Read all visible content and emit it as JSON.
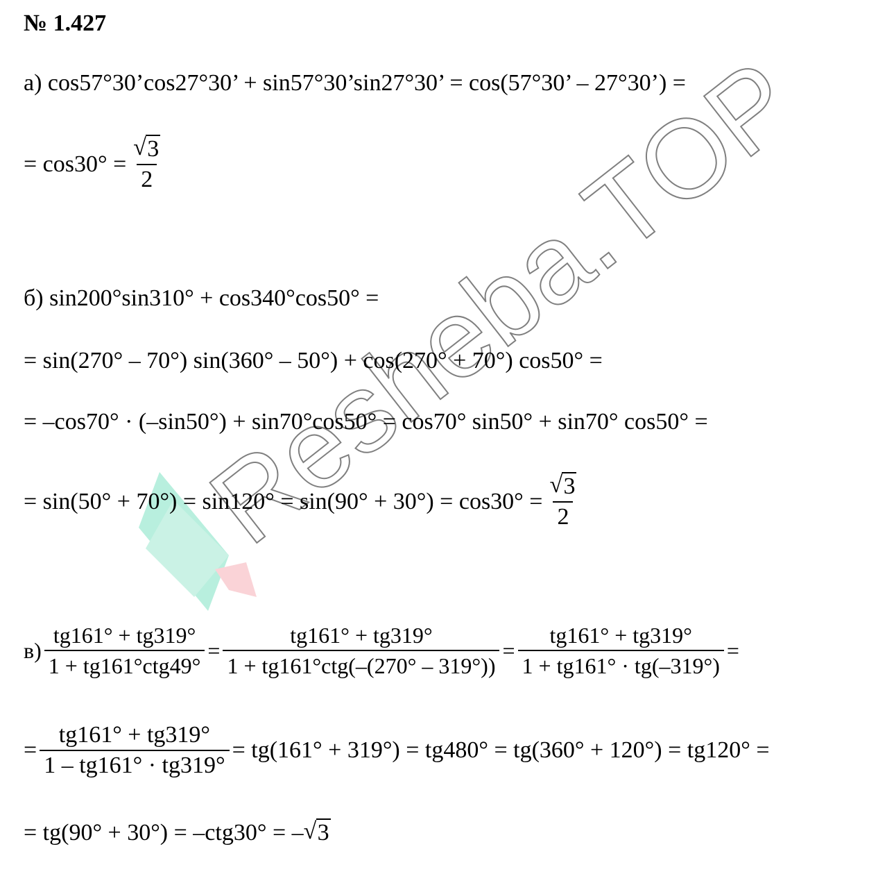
{
  "problem_number": "№ 1.427",
  "part_a": {
    "line1": "а) cos57°30’cos27°30’ + sin57°30’sin27°30’ = cos(57°30’ – 27°30’) =",
    "line2_lhs": "= cos30° =",
    "frac_num_radicand": "3",
    "frac_den": "2"
  },
  "part_b": {
    "line1": "б) sin200°sin310° + cos340°cos50° =",
    "line2": "= sin(270° – 70°) sin(360° – 50°) + cos(270° + 70°) cos50° =",
    "line3": "= –cos70° · (–sin50°) + sin70°cos50° = cos70° sin50° + sin70° cos50° =",
    "line4_lhs": "= sin(50° + 70°) = sin120° = sin(90° + 30°) = cos30° =",
    "frac_num_radicand": "3",
    "frac_den": "2"
  },
  "part_c": {
    "label": "в)",
    "f1_num": "tg161° + tg319°",
    "f1_den": "1 + tg161°ctg49°",
    "f2_num": "tg161° + tg319°",
    "f2_den": "1 + tg161°ctg(–(270° – 319°))",
    "f3_num": "tg161° + tg319°",
    "f3_den": "1 + tg161° · tg(–319°)",
    "eq": "=",
    "f4_num": "tg161° + tg319°",
    "f4_den": "1 – tg161° · tg319°",
    "line2_rhs": "= tg(161° + 319°) = tg480° = tg(360° + 120°) = tg120° =",
    "line3_lhs": "= tg(90° + 30°) = –ctg30° = –",
    "line3_radicand": "3"
  },
  "watermark": {
    "text": "Reshebа.TOP",
    "colors": {
      "green": "#7fe3c4",
      "pink": "#f7b0b8",
      "stroke": "#555555"
    }
  }
}
